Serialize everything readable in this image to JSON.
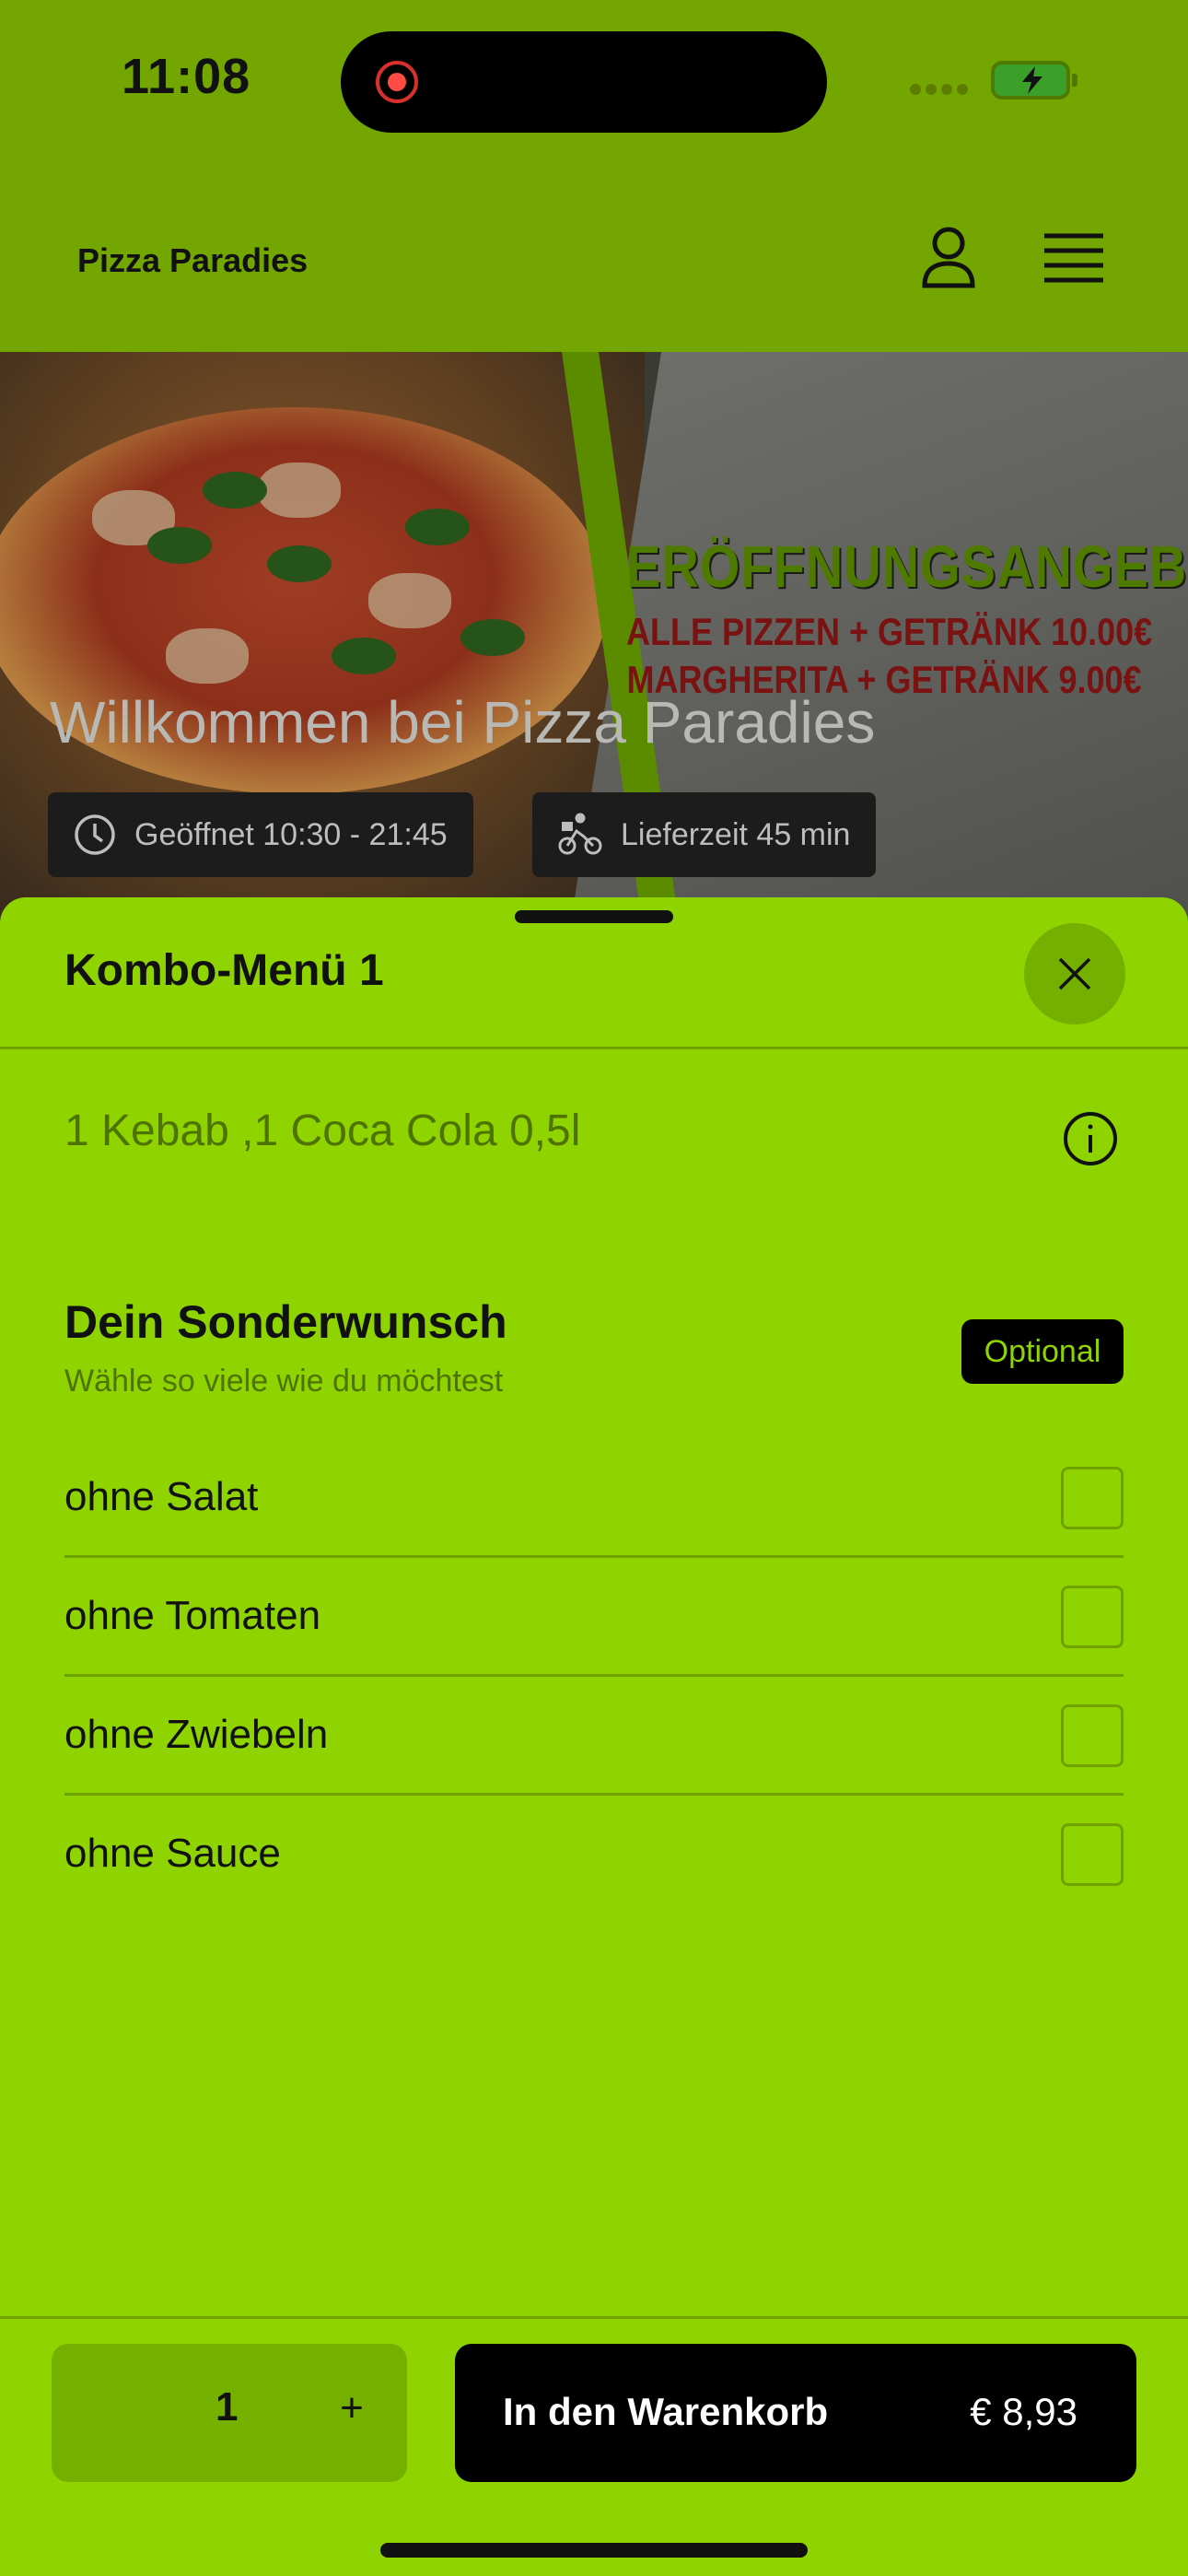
{
  "status_bar": {
    "time": "11:08"
  },
  "header": {
    "app_title": "Pizza Paradies",
    "profile_icon": "user-icon",
    "menu_icon": "hamburger-menu-icon"
  },
  "hero": {
    "promo_title": "ERÖFFNUNGSANGEBOT",
    "promo_line_1": "ALLE PIZZEN + GETRÄNK 10.00€",
    "promo_line_2": "MARGHERITA + GETRÄNK 9.00€",
    "welcome": "Willkommen bei Pizza Paradies",
    "opening_hours": "Geöffnet 10:30 - 21:45",
    "delivery_time": "Lieferzeit 45 min"
  },
  "sheet": {
    "title": "Kombo-Menü 1",
    "description": "1 Kebab ,1 Coca Cola 0,5l",
    "section": {
      "title": "Dein Sonderwunsch",
      "subtitle": "Wähle so viele wie du möchtest",
      "badge": "Optional",
      "options": [
        {
          "label": "ohne Salat",
          "checked": false
        },
        {
          "label": "ohne Tomaten",
          "checked": false
        },
        {
          "label": "ohne Zwiebeln",
          "checked": false
        },
        {
          "label": "ohne Sauce",
          "checked": false
        }
      ]
    }
  },
  "footer": {
    "quantity": "1",
    "plus_label": "+",
    "add_to_cart_label": "In den Warenkorb",
    "price": "€ 8,93"
  },
  "colors": {
    "accent": "#8fd400",
    "accent_dark": "#75b000",
    "divider": "#6ea200",
    "button_bg": "#000000"
  }
}
